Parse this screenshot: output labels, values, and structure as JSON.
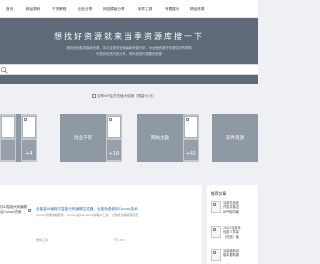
{
  "nav": {
    "items": [
      "首页",
      "精品源码",
      "干货教程",
      "创业分享",
      "网站模板分享",
      "软件工具",
      "专题展示",
      "精品资源"
    ]
  },
  "hero": {
    "title": "想找好资源就来当季资源库搜一下",
    "line1": "提供全面各类最新资源，本平台提供全面最新资源分享，为全面资源分享提供好的帮助",
    "line2": "可提供优质内容分享，帮你找到你想要的资源"
  },
  "search": {
    "placeholder": ""
  },
  "banner": {
    "text": "当季VIP会员充值大促销（限量91元）"
  },
  "categories": [
    {
      "title": "",
      "count": "+4"
    },
    {
      "title": "创业干货",
      "count": "+18"
    },
    {
      "title": "网站主题",
      "count": "+41"
    },
    {
      "title": "软件资源",
      "count": ""
    }
  ],
  "left_fragment": {
    "line1": "件AI智能代码编辑",
    "line2": "合Cursor完美"
  },
  "article": {
    "title": "全能量AI编程与智能代码编辑生成器，全能免费使用Cursor技术",
    "excerpt": "Cursor智能编程软件，Cursor是full-stack编程AI工具，让你成为超级程序员",
    "tag": "软件工具",
    "views": "203"
  },
  "sidebar": {
    "heading": "推荐文章",
    "items": [
      {
        "lines": [
          "当量件适宜",
          "开发并接近",
          "APP软件编"
        ]
      },
      {
        "lines": [
          "2022当量年",
          "优质人员量",
          "（在线）客"
        ]
      },
      {
        "lines": [
          "当量最新设",
          "版本更新源"
        ]
      }
    ]
  },
  "colors": {
    "hero_bg": "#5e6a78",
    "card_bg": "#8f99a4",
    "link": "#2b6cb0",
    "page_bg": "#eef0f3"
  },
  "icons": {
    "search": "search-icon",
    "views": "eye-icon"
  }
}
